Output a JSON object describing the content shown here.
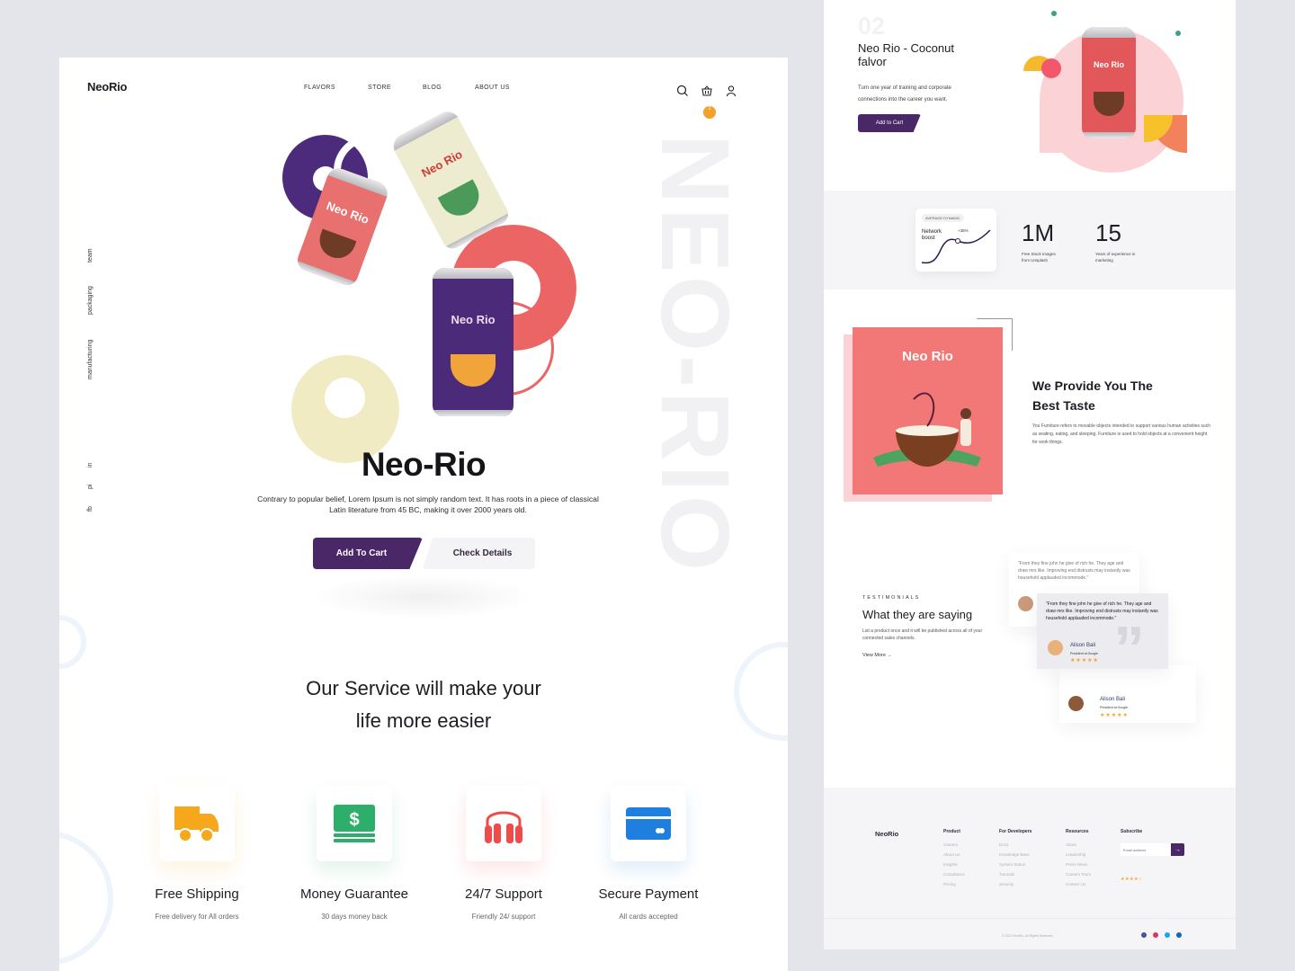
{
  "left": {
    "logo": "NeoRio",
    "nav": [
      "FLAVORS",
      "STORE",
      "BLOG",
      "ABOUT US"
    ],
    "header_icons": [
      "search-icon",
      "basket-icon",
      "user-icon"
    ],
    "cart_count": "2",
    "side_links": [
      "team",
      "packaging",
      "manufacturing"
    ],
    "social": [
      "in",
      "pi",
      "fb"
    ],
    "watermark": "NEO-RIO",
    "cans": [
      {
        "label": "Neo Rio",
        "color": "#e8706e"
      },
      {
        "label": "Neo Rio",
        "color": "#eeecd0"
      },
      {
        "label": "Neo Rio",
        "color": "#4b2a7a"
      }
    ],
    "hero": {
      "title": "Neo-Rio",
      "description": "Contrary to popular belief, Lorem Ipsum is not simply random text. It has roots in a piece of classical Latin literature from 45 BC, making it over 2000 years old.",
      "primary_button": "Add To Cart",
      "secondary_button": "Check Details"
    },
    "services": {
      "title_line1": "Our Service will make your",
      "title_line2": "life more easier",
      "items": [
        {
          "name": "Free Shipping",
          "sub": "Free delivery for All orders",
          "icon": "truck-icon",
          "color": "#f6a81d"
        },
        {
          "name": "Money Guarantee",
          "sub": "30 days money back",
          "icon": "money-icon",
          "color": "#2eae6b"
        },
        {
          "name": "24/7 Support",
          "sub": "Friendly 24/ support",
          "icon": "headphones-icon",
          "color": "#ef4b4b"
        },
        {
          "name": "Secure Payment",
          "sub": "All cards accepted",
          "icon": "credit-card-icon",
          "color": "#1f7fde"
        }
      ]
    }
  },
  "right": {
    "product": {
      "number": "02",
      "title_line1": "Neo Rio - Coconut",
      "title_line2": "falvor",
      "desc_line1": "Turn one year of training and corporate",
      "desc_line2": "connections into the career you want.",
      "button": "Add to Cart",
      "can_label": "Neo Rio"
    },
    "stats": {
      "pill": "AVERAGE DYNAMIC",
      "card_label_line1": "Network",
      "card_label_line2": "boost",
      "card_pct": "+35%",
      "stat1_value": "1M",
      "stat1_line1": "Free Stock Images",
      "stat1_line2": "from Unsplash",
      "stat2_value": "15",
      "stat2_line1": "Years of experience in",
      "stat2_line2": "marketing"
    },
    "best": {
      "card_title": "Neo Rio",
      "heading_line1": "We Provide You The",
      "heading_line2": "Best Taste",
      "paragraph": "You Furniture refers to movable objects intended to support various human activities such as seating, eating, and sleeping. Furniture is used to hold objects at a convenient height for work things."
    },
    "testimonials": {
      "label": "TESTIMONIALS",
      "heading": "What they are saying",
      "desc": "List a product once and it will be published across all of your connected sales channels.",
      "view_more": "View More",
      "quote": "\"From they fine john he give of rich he. They age and draw mrs like. Improving end distrusts may instantly was household applauded incommode.\"",
      "name": "Alison Bali",
      "role": "President at Google",
      "stars": "★★★★★"
    },
    "footer": {
      "logo": "NeoRio",
      "columns": [
        {
          "title": "Product",
          "links": [
            "Careers",
            "About Us",
            "Insights",
            "Compliance",
            "Pricing"
          ]
        },
        {
          "title": "For Developers",
          "links": [
            "Docs",
            "Knowledge Base",
            "System Status",
            "Tutorials",
            "Security"
          ]
        },
        {
          "title": "Resources",
          "links": [
            "About",
            "Leadership",
            "Press News",
            "Careers Team",
            "Contact Us"
          ]
        }
      ],
      "subscribe_title": "Subscribe",
      "email_placeholder": "Email address",
      "rating": "★★★★☆",
      "copyright": "© 2021 NeoRio. All Rights Reserved",
      "social_icons": [
        "facebook-icon",
        "instagram-icon",
        "twitter-icon",
        "linkedin-icon"
      ]
    }
  }
}
